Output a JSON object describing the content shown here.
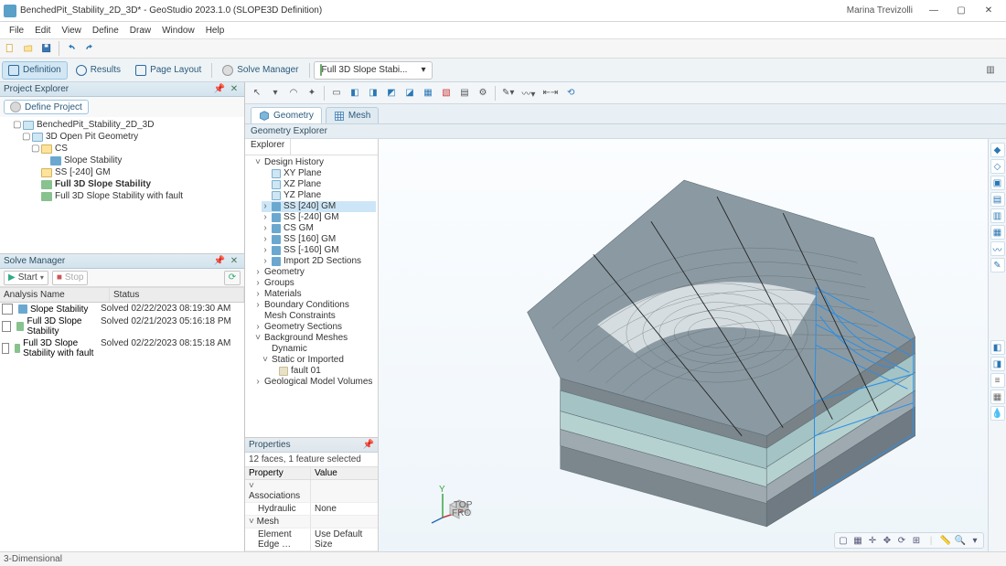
{
  "app": {
    "title": "BenchedPit_Stability_2D_3D* - GeoStudio 2023.1.0 (SLOPE3D Definition)",
    "user": "Marina Trevizolli"
  },
  "menu": [
    "File",
    "Edit",
    "View",
    "Define",
    "Draw",
    "Window",
    "Help"
  ],
  "ribbon": {
    "definition": "Definition",
    "results": "Results",
    "page_layout": "Page Layout",
    "solve_manager": "Solve Manager",
    "analysis_dd": "Full 3D Slope Stabi..."
  },
  "panels": {
    "project_explorer": "Project Explorer",
    "define_project": "Define Project",
    "solve_manager": "Solve Manager",
    "geometry_explorer": "Geometry Explorer",
    "explorer_tab": "Explorer",
    "properties": "Properties"
  },
  "project_tree": {
    "root": "BenchedPit_Stability_2D_3D",
    "geo": "3D Open Pit Geometry",
    "cs": "CS",
    "slope": "Slope Stability",
    "ss": "SS [-240] GM",
    "full3d": "Full 3D Slope Stability",
    "full3d_fault": "Full 3D Slope Stability with fault"
  },
  "solve": {
    "start": "Start",
    "stop": "Stop",
    "col_name": "Analysis Name",
    "col_status": "Status",
    "rows": [
      {
        "name": "Slope Stability",
        "status": "Solved 02/22/2023 08:19:30 AM"
      },
      {
        "name": "Full 3D Slope Stability",
        "status": "Solved 02/21/2023 05:16:18 PM"
      },
      {
        "name": "Full 3D Slope Stability with fault",
        "status": "Solved 02/22/2023 08:15:18 AM"
      }
    ]
  },
  "geo_tree": {
    "dh": "Design History",
    "xy": "XY Plane",
    "xz": "XZ Plane",
    "yz": "YZ Plane",
    "ss240": "SS [240] GM",
    "ssm240": "SS [-240] GM",
    "csgm": "CS GM",
    "ss160": "SS [160] GM",
    "ssm160": "SS [-160] GM",
    "import2d": "Import 2D Sections",
    "geometry": "Geometry",
    "groups": "Groups",
    "materials": "Materials",
    "bc": "Boundary Conditions",
    "meshc": "Mesh Constraints",
    "gs": "Geometry Sections",
    "bgm": "Background Meshes",
    "dynamic": "Dynamic",
    "soi": "Static or Imported",
    "fault01": "fault 01",
    "gmv": "Geological Model Volumes"
  },
  "center_tabs": {
    "geometry": "Geometry",
    "mesh": "Mesh"
  },
  "props": {
    "info": "12 faces, 1 feature selected",
    "col_prop": "Property",
    "col_val": "Value",
    "g_assoc": "Associations",
    "hydraulic": "Hydraulic",
    "hydraulic_v": "None",
    "g_mesh": "Mesh",
    "ees": "Element Edge …",
    "ees_v": "Use Default Size"
  },
  "statusbar": {
    "left": "3-Dimensional"
  }
}
